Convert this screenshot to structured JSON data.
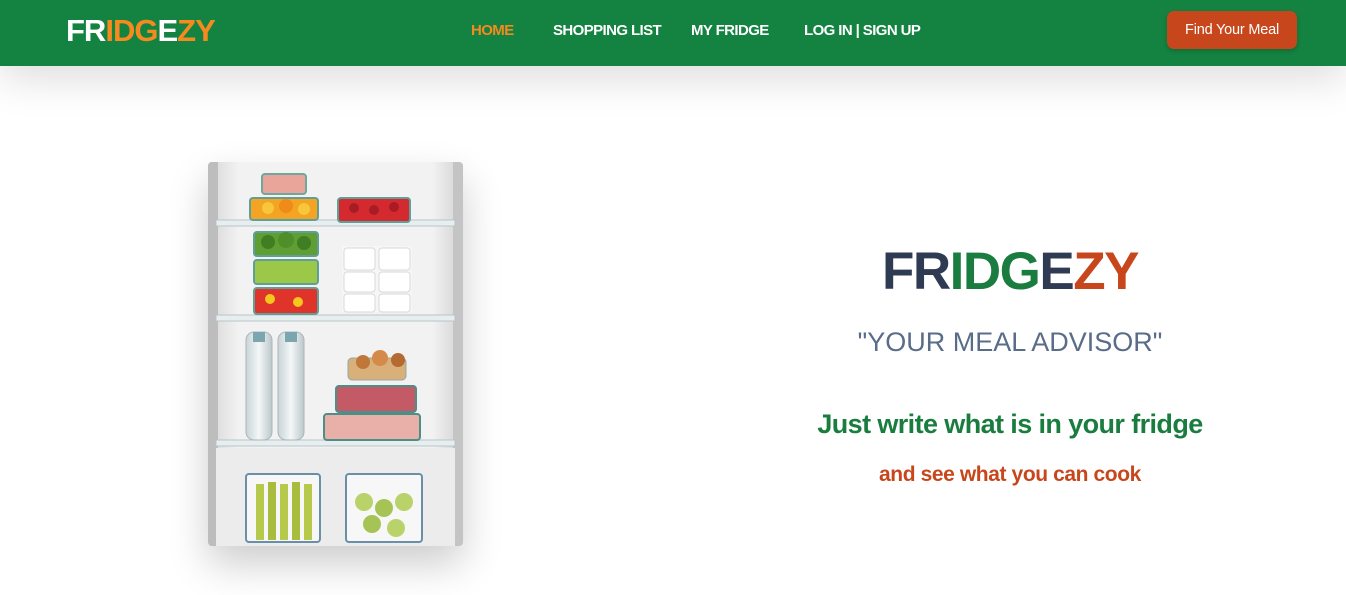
{
  "nav": {
    "brand": {
      "parts": [
        "FR",
        "IDG",
        "E",
        "ZY"
      ]
    },
    "links": [
      "HOME",
      "SHOPPING LIST",
      "MY FRIDGE",
      "LOG IN | SIGN UP"
    ],
    "active": "HOME",
    "cta_label": "Find Your Meal"
  },
  "hero": {
    "title_parts": [
      "FR",
      "IDG",
      "E",
      "ZY"
    ],
    "subtitle": "\"YOUR MEAL ADVISOR\"",
    "tagline": "Just write what is in your fridge",
    "sub_tagline": "and see what you can cook"
  },
  "colors": {
    "navbar_bg": "#148240",
    "brand_white": "#ffffff",
    "brand_orange": "#f58a1f",
    "nav_active": "#f58a1f",
    "cta_bg": "#c8461b",
    "title_dark": "#2f3b52",
    "title_green": "#1a7d3f",
    "title_orange": "#c8461b",
    "subtitle": "#596c88",
    "tagline_green": "#1a7d3f",
    "sub_tagline_red": "#c8461b"
  },
  "image": {
    "icon": "fridge-photo",
    "description_hidden": true
  }
}
